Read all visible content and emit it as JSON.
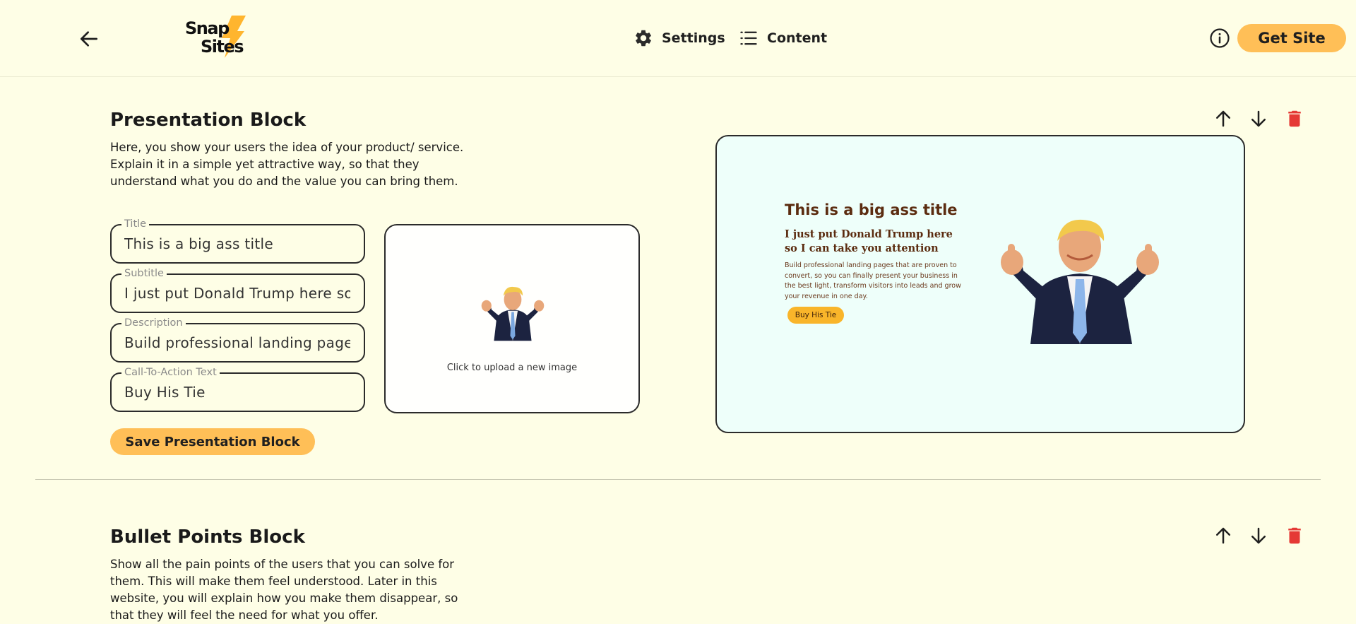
{
  "header": {
    "logo_line1": "Snap",
    "logo_line2": "Sites",
    "nav": {
      "settings_label": "Settings",
      "content_label": "Content"
    },
    "get_site_label": "Get Site"
  },
  "presentation_block": {
    "title": "Presentation Block",
    "description": "Here, you show your users the idea of your product/ service. Explain it in a simple yet attractive way, so that they understand what you do and the value you can bring them.",
    "fields": {
      "title": {
        "label": "Title",
        "value": "This is a big ass title"
      },
      "subtitle": {
        "label": "Subtitle",
        "value": "I just put Donald Trump here so I can take you attention"
      },
      "description": {
        "label": "Description",
        "value": "Build professional landing pages that are proven to convert, so you can finally present your business in the best light, transform visitors into leads and grow your revenue in one day."
      },
      "cta": {
        "label": "Call-To-Action Text",
        "value": "Buy His Tie"
      }
    },
    "upload_text": "Click to upload a new image",
    "save_label": "Save Presentation Block",
    "preview": {
      "title": "This is a big ass title",
      "subtitle": "I just put Donald Trump here so I can take you attention",
      "description": "Build professional landing pages that are proven to convert, so you can finally present your business in the best light, transform visitors into leads and grow your revenue in one day.",
      "cta": "Buy His Tie"
    }
  },
  "bullet_points_block": {
    "title": "Bullet Points Block",
    "description": "Show all the pain points of the users that you can solve for them. This will make them feel understood. Later in this website, you will explain how you make them disappear, so that they will feel the need for what you offer."
  },
  "colors": {
    "background": "#fefee6",
    "accent": "#ffbf57",
    "preview_bg": "#eefffa",
    "preview_text": "#5b2c10",
    "delete_red": "#e53935"
  },
  "icons": {
    "back": "arrow-left-icon",
    "settings": "gear-icon",
    "content": "list-icon",
    "info": "info-icon",
    "move_up": "arrow-up-icon",
    "move_down": "arrow-down-icon",
    "delete": "trash-icon"
  }
}
